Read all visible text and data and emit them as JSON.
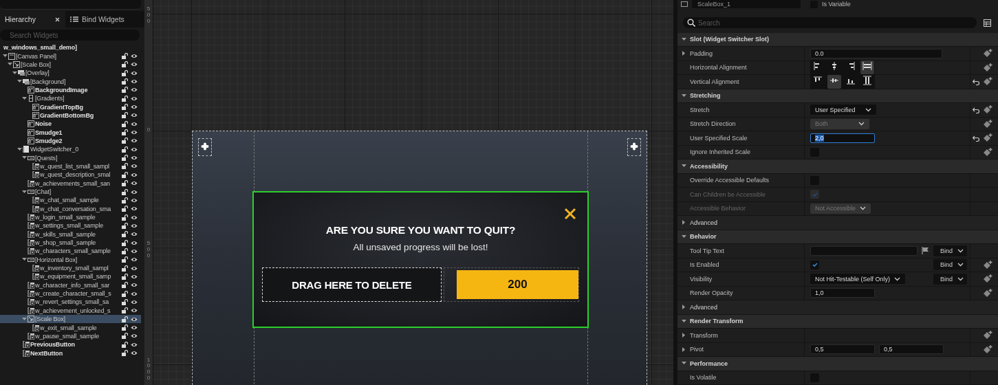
{
  "hierarchy_panel": {
    "tabs": [
      {
        "label": "Hierarchy",
        "selected": true,
        "closable": true,
        "kind": "plain"
      },
      {
        "label": "Bind Widgets",
        "selected": false,
        "closable": false,
        "kind": "list"
      }
    ],
    "search": {
      "placeholder": "Search Widgets"
    },
    "tree": [
      {
        "label": "w_windows_small_demo]",
        "bold": true,
        "selected": false,
        "children": [
          {
            "label": "[Canvas Panel]",
            "kind": "canvas",
            "bold": false,
            "selected": false,
            "expanded": true,
            "children": [
              {
                "label": "[Scale Box]",
                "kind": "scalebox",
                "bold": false,
                "selected": false,
                "expanded": true,
                "children": [
                  {
                    "label": "[Overlay]",
                    "kind": "overlay",
                    "bold": false,
                    "selected": false,
                    "expanded": true,
                    "children": [
                      {
                        "label": "[Background]",
                        "kind": "overlay",
                        "bold": false,
                        "selected": false,
                        "expanded": true,
                        "children": [
                          {
                            "label": "BackgroundImage",
                            "kind": "image",
                            "bold": true,
                            "selected": false
                          },
                          {
                            "label": "[Gradients]",
                            "kind": "vbox",
                            "bold": false,
                            "selected": false,
                            "expanded": true,
                            "children": [
                              {
                                "label": "GradientTopBg",
                                "kind": "image",
                                "bold": true,
                                "selected": false
                              },
                              {
                                "label": "GradientBottomBg",
                                "kind": "image",
                                "bold": true,
                                "selected": false
                              }
                            ]
                          },
                          {
                            "label": "Noise",
                            "kind": "image",
                            "bold": true,
                            "selected": false
                          },
                          {
                            "label": "Smudge1",
                            "kind": "image",
                            "bold": true,
                            "selected": false
                          },
                          {
                            "label": "Smudge2",
                            "kind": "image",
                            "bold": true,
                            "selected": false
                          }
                        ]
                      },
                      {
                        "label": "WidgetSwitcher_0",
                        "kind": "switcher",
                        "bold": false,
                        "selected": false,
                        "expanded": true,
                        "children": [
                          {
                            "label": "[Quests]",
                            "kind": "hbox",
                            "bold": false,
                            "selected": false,
                            "expanded": true,
                            "children": [
                              {
                                "label": "w_quest_list_small_sampl",
                                "kind": "widget",
                                "bold": false,
                                "selected": false
                              },
                              {
                                "label": "w_quest_description_smal",
                                "kind": "widget",
                                "bold": false,
                                "selected": false
                              }
                            ]
                          },
                          {
                            "label": "w_achievements_small_san",
                            "kind": "widget",
                            "bold": false,
                            "selected": false
                          },
                          {
                            "label": "[Chat]",
                            "kind": "hbox",
                            "bold": false,
                            "selected": false,
                            "expanded": true,
                            "children": [
                              {
                                "label": "w_chat_small_sample",
                                "kind": "widget",
                                "bold": false,
                                "selected": false
                              },
                              {
                                "label": "w_chat_conversation_sma",
                                "kind": "widget",
                                "bold": false,
                                "selected": false
                              }
                            ]
                          },
                          {
                            "label": "w_login_small_sample",
                            "kind": "widget",
                            "bold": false,
                            "selected": false
                          },
                          {
                            "label": "w_settings_small_sample",
                            "kind": "widget",
                            "bold": false,
                            "selected": false
                          },
                          {
                            "label": "w_skills_small_sample",
                            "kind": "widget",
                            "bold": false,
                            "selected": false
                          },
                          {
                            "label": "w_shop_small_sample",
                            "kind": "widget",
                            "bold": false,
                            "selected": false
                          },
                          {
                            "label": "w_characters_small_sample",
                            "kind": "widget",
                            "bold": false,
                            "selected": false
                          },
                          {
                            "label": "[Horizontal Box]",
                            "kind": "hbox",
                            "bold": false,
                            "selected": false,
                            "expanded": true,
                            "children": [
                              {
                                "label": "w_inventory_small_sampl",
                                "kind": "widget",
                                "bold": false,
                                "selected": false
                              },
                              {
                                "label": "w_equipment_small_samp",
                                "kind": "widget",
                                "bold": false,
                                "selected": false
                              }
                            ]
                          },
                          {
                            "label": "w_character_info_small_sar",
                            "kind": "widget",
                            "bold": false,
                            "selected": false
                          },
                          {
                            "label": "w_create_character_small_s",
                            "kind": "widget",
                            "bold": false,
                            "selected": false
                          },
                          {
                            "label": "w_revert_settings_small_sa",
                            "kind": "widget",
                            "bold": false,
                            "selected": false
                          },
                          {
                            "label": "w_achievement_unlocked_s",
                            "kind": "widget",
                            "bold": false,
                            "selected": false
                          },
                          {
                            "label": "[Scale Box]",
                            "kind": "scalebox",
                            "bold": false,
                            "selected": true,
                            "expanded": true,
                            "children": [
                              {
                                "label": "w_exit_small_sample",
                                "kind": "widget",
                                "bold": false,
                                "selected": false
                              }
                            ]
                          },
                          {
                            "label": "w_pause_small_sample",
                            "kind": "widget",
                            "bold": false,
                            "selected": false
                          }
                        ]
                      },
                      {
                        "label": "PreviousButton",
                        "kind": "widget",
                        "bold": true,
                        "selected": false
                      },
                      {
                        "label": "NextButton",
                        "kind": "widget",
                        "bold": true,
                        "selected": false
                      }
                    ]
                  }
                ]
              }
            ]
          }
        ]
      }
    ]
  },
  "designer": {
    "ruler_labels": [
      "500",
      "0",
      "500",
      "1000"
    ],
    "preview": {
      "title": "ARE YOU SURE YOU WANT TO QUIT?",
      "message": "All unsaved progress will be lost!",
      "buttons": [
        {
          "label": "DRAG HERE TO DELETE",
          "kind": "dark"
        },
        {
          "label": "200",
          "kind": "accent"
        }
      ]
    }
  },
  "details_panel": {
    "name_field": {
      "value": "ScaleBox_1"
    },
    "is_variable": {
      "label": "Is Variable",
      "checked": false
    },
    "search": {
      "placeholder": "Search"
    },
    "rows": [
      {
        "kind": "section",
        "label": "Slot (Widget Switcher Slot)",
        "expanded": true
      },
      {
        "kind": "property",
        "label": "Padding",
        "expanded": false,
        "disabled": false,
        "reset": false,
        "keyframe": true,
        "controls": [
          {
            "kind": "vector",
            "value": "0.0"
          }
        ]
      },
      {
        "kind": "property",
        "label": "Horizontal Alignment",
        "disabled": false,
        "reset": false,
        "keyframe": true,
        "controls": [
          {
            "kind": "align",
            "options": [
              {
                "kind": "left",
                "selected": false
              },
              {
                "kind": "center",
                "selected": false
              },
              {
                "kind": "right",
                "selected": false
              },
              {
                "kind": "hfill",
                "selected": true
              }
            ]
          }
        ]
      },
      {
        "kind": "property",
        "label": "Vertical Alignment",
        "disabled": false,
        "reset": true,
        "keyframe": true,
        "controls": [
          {
            "kind": "align",
            "options": [
              {
                "kind": "top",
                "selected": false
              },
              {
                "kind": "middle",
                "selected": true
              },
              {
                "kind": "bottom",
                "selected": false
              },
              {
                "kind": "vfill",
                "selected": false
              }
            ]
          }
        ]
      },
      {
        "kind": "section",
        "label": "Stretching",
        "expanded": true
      },
      {
        "kind": "property",
        "label": "Stretch",
        "disabled": false,
        "reset": true,
        "keyframe": true,
        "controls": [
          {
            "kind": "dropdown",
            "value": "User Specified",
            "disabled": false
          }
        ]
      },
      {
        "kind": "property",
        "label": "Stretch Direction",
        "disabled": false,
        "reset": false,
        "keyframe": true,
        "controls": [
          {
            "kind": "dropdown",
            "value": "Both",
            "disabled": true
          }
        ]
      },
      {
        "kind": "property",
        "label": "User Specified Scale",
        "disabled": false,
        "reset": true,
        "keyframe": true,
        "controls": [
          {
            "kind": "number",
            "value": "2,0",
            "focused": true
          }
        ]
      },
      {
        "kind": "property",
        "label": "Ignore Inherited Scale",
        "disabled": false,
        "reset": false,
        "keyframe": true,
        "controls": [
          {
            "kind": "checkbox",
            "checked": false,
            "disabled": false
          }
        ]
      },
      {
        "kind": "section",
        "label": "Accessibility",
        "expanded": true
      },
      {
        "kind": "property",
        "label": "Override Accessible Defaults",
        "disabled": false,
        "reset": false,
        "keyframe": false,
        "controls": [
          {
            "kind": "checkbox",
            "checked": false,
            "disabled": false
          }
        ]
      },
      {
        "kind": "property",
        "label": "Can Children be Accessible",
        "disabled": true,
        "reset": false,
        "keyframe": false,
        "controls": [
          {
            "kind": "checkbox",
            "checked": true,
            "disabled": true
          }
        ]
      },
      {
        "kind": "property",
        "label": "Accessible Behavior",
        "disabled": true,
        "reset": false,
        "keyframe": false,
        "controls": [
          {
            "kind": "dropdown",
            "value": "Not Accessible",
            "disabled": true
          }
        ]
      },
      {
        "kind": "group",
        "label": "Advanced",
        "expanded": false
      },
      {
        "kind": "section",
        "label": "Behavior",
        "expanded": true
      },
      {
        "kind": "property",
        "label": "Tool Tip Text",
        "disabled": false,
        "reset": false,
        "keyframe": false,
        "controls": [
          {
            "kind": "text"
          },
          {
            "kind": "flag"
          }
        ],
        "binding": "Bind"
      },
      {
        "kind": "property",
        "label": "Is Enabled",
        "disabled": false,
        "reset": false,
        "keyframe": true,
        "controls": [
          {
            "kind": "checkbox",
            "checked": true,
            "disabled": false
          }
        ],
        "binding": "Bind"
      },
      {
        "kind": "property",
        "label": "Visibility",
        "disabled": false,
        "reset": false,
        "keyframe": true,
        "controls": [
          {
            "kind": "dropdown",
            "value": "Not Hit-Testable (Self Only)",
            "disabled": false
          }
        ],
        "binding": "Bind"
      },
      {
        "kind": "property",
        "label": "Render Opacity",
        "disabled": false,
        "reset": false,
        "keyframe": true,
        "controls": [
          {
            "kind": "number",
            "value": "1,0",
            "focused": false
          }
        ]
      },
      {
        "kind": "group",
        "label": "Advanced",
        "expanded": false
      },
      {
        "kind": "section",
        "label": "Render Transform",
        "expanded": true
      },
      {
        "kind": "property",
        "label": "Transform",
        "expanded": false,
        "disabled": false,
        "reset": false,
        "keyframe": true,
        "controls": []
      },
      {
        "kind": "property",
        "label": "Pivot",
        "expanded": false,
        "disabled": false,
        "reset": false,
        "keyframe": true,
        "controls": [
          {
            "kind": "number",
            "value": "0,5",
            "focused": false
          },
          {
            "kind": "number",
            "value": "0,5",
            "focused": false
          }
        ]
      },
      {
        "kind": "section",
        "label": "Performance",
        "expanded": true
      },
      {
        "kind": "property",
        "label": "Is Volatile",
        "disabled": false,
        "reset": false,
        "keyframe": false,
        "controls": [
          {
            "kind": "checkbox",
            "checked": false,
            "disabled": false
          }
        ]
      }
    ]
  }
}
